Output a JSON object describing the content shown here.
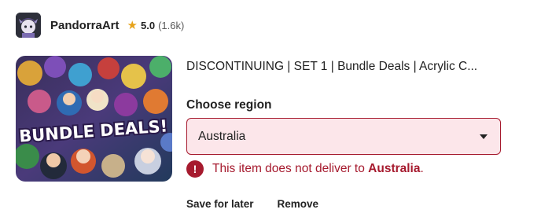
{
  "shop": {
    "name": "PandorraArt",
    "rating": "5.0",
    "review_count": "(1.6k)",
    "star_icon": "star-icon"
  },
  "product": {
    "title": "DISCONTINUING | SET 1 | Bundle Deals | Acrylic C...",
    "image_banner_text": "BUNDLE DEALS!"
  },
  "region": {
    "label": "Choose region",
    "selected": "Australia",
    "caret_icon": "caret-down-icon"
  },
  "error": {
    "icon": "alert-icon",
    "icon_glyph": "!",
    "message_prefix": "This item does not deliver to ",
    "message_region": "Australia",
    "message_suffix": "."
  },
  "actions": {
    "save_label": "Save for later",
    "remove_label": "Remove"
  },
  "colors": {
    "error": "#a61a2e",
    "error_bg": "#fce6ea",
    "star": "#e6a21a"
  }
}
